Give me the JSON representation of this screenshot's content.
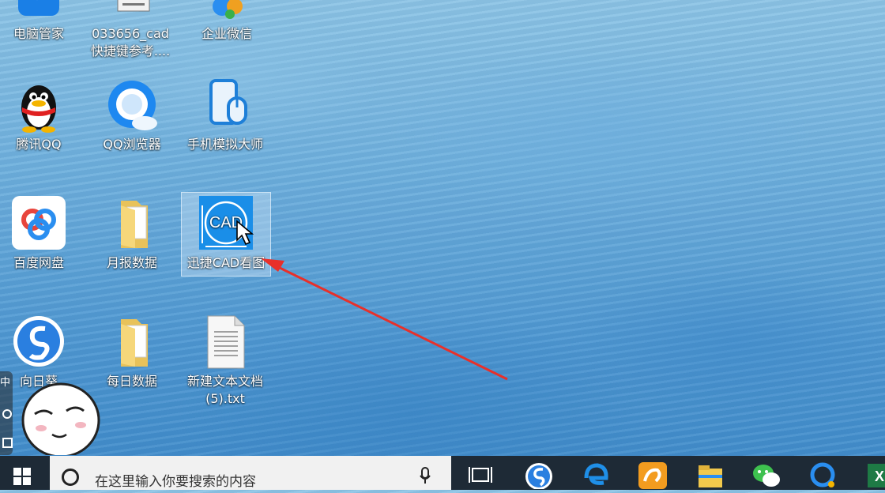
{
  "desktop": {
    "icons": [
      {
        "name": "电脑管家"
      },
      {
        "name": "033656_cad",
        "name2": "快捷键参考...."
      },
      {
        "name": "企业微信"
      },
      {
        "name": "腾讯QQ"
      },
      {
        "name": "QQ浏览器"
      },
      {
        "name": "手机模拟大师"
      },
      {
        "name": "百度网盘"
      },
      {
        "name": "月报数据"
      },
      {
        "name": "迅捷CAD看图",
        "badge": "CAD"
      },
      {
        "name": "向日葵"
      },
      {
        "name": "每日数据"
      },
      {
        "name": "新建文本文档",
        "name2": "(5).txt"
      }
    ],
    "ime_indicator": "中"
  },
  "taskbar": {
    "search_placeholder": "在这里输入你要搜索的内容",
    "pinned": [
      "task-view-icon",
      "sogou-browser-icon",
      "edge-icon",
      "uc-browser-icon",
      "file-explorer-icon",
      "wechat-icon",
      "qq-browser-icon",
      "excel-icon"
    ]
  },
  "colors": {
    "annotation_arrow": "#e8302a",
    "taskbar": "#1e2a36"
  }
}
